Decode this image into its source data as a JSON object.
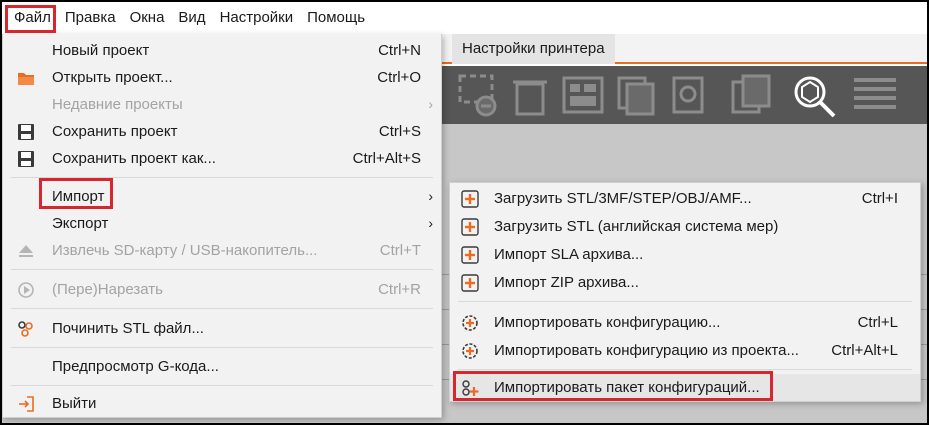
{
  "menubar": {
    "items": [
      "Файл",
      "Правка",
      "Окна",
      "Вид",
      "Настройки",
      "Помощь"
    ]
  },
  "app": {
    "tab_label": "Настройки принтера"
  },
  "file_menu": {
    "items": [
      {
        "label": "Новый проект",
        "shortcut": "Ctrl+N",
        "icon": "none"
      },
      {
        "label": "Открыть проект...",
        "shortcut": "Ctrl+O",
        "icon": "folder-icon"
      },
      {
        "label": "Недавние проекты",
        "shortcut": "",
        "icon": "none",
        "disabled": true,
        "submenu": true
      },
      {
        "label": "Сохранить проект",
        "shortcut": "Ctrl+S",
        "icon": "save-icon"
      },
      {
        "label": "Сохранить проект как...",
        "shortcut": "Ctrl+Alt+S",
        "icon": "save-as-icon"
      },
      {
        "label": "Импорт",
        "shortcut": "",
        "icon": "none",
        "submenu": true
      },
      {
        "label": "Экспорт",
        "shortcut": "",
        "icon": "none",
        "submenu": true
      },
      {
        "label": "Извлечь SD-карту / USB-накопитель...",
        "shortcut": "Ctrl+T",
        "icon": "eject-icon",
        "disabled": true
      },
      {
        "label": "(Пере)Нарезать",
        "shortcut": "Ctrl+R",
        "icon": "slice-icon",
        "disabled": true
      },
      {
        "label": "Починить STL файл...",
        "shortcut": "",
        "icon": "repair-icon"
      },
      {
        "label": "Предпросмотр G-кода...",
        "shortcut": "",
        "icon": "none"
      },
      {
        "label": "Выйти",
        "shortcut": "",
        "icon": "exit-icon"
      }
    ]
  },
  "import_submenu": {
    "items": [
      {
        "label": "Загрузить STL/3MF/STEP/OBJ/AMF...",
        "shortcut": "Ctrl+I",
        "icon": "plus-icon"
      },
      {
        "label": "Загрузить STL (английская система мер)",
        "shortcut": "",
        "icon": "plus-icon"
      },
      {
        "label": "Импорт SLA архива...",
        "shortcut": "",
        "icon": "plus-icon"
      },
      {
        "label": "Импорт ZIP архива...",
        "shortcut": "",
        "icon": "plus-icon"
      },
      {
        "label": "Импортировать конфигурацию...",
        "shortcut": "Ctrl+L",
        "icon": "config-import-icon"
      },
      {
        "label": "Импортировать конфигурацию из проекта...",
        "shortcut": "Ctrl+Alt+L",
        "icon": "config-import-icon"
      },
      {
        "label": "Импортировать пакет конфигураций...",
        "shortcut": "",
        "icon": "config-bundle-icon"
      }
    ]
  },
  "colors": {
    "accent": "#ed6b21",
    "highlight": "#d7262e",
    "toolbar": "#565656",
    "disabled_text": "#a3a3a3"
  }
}
